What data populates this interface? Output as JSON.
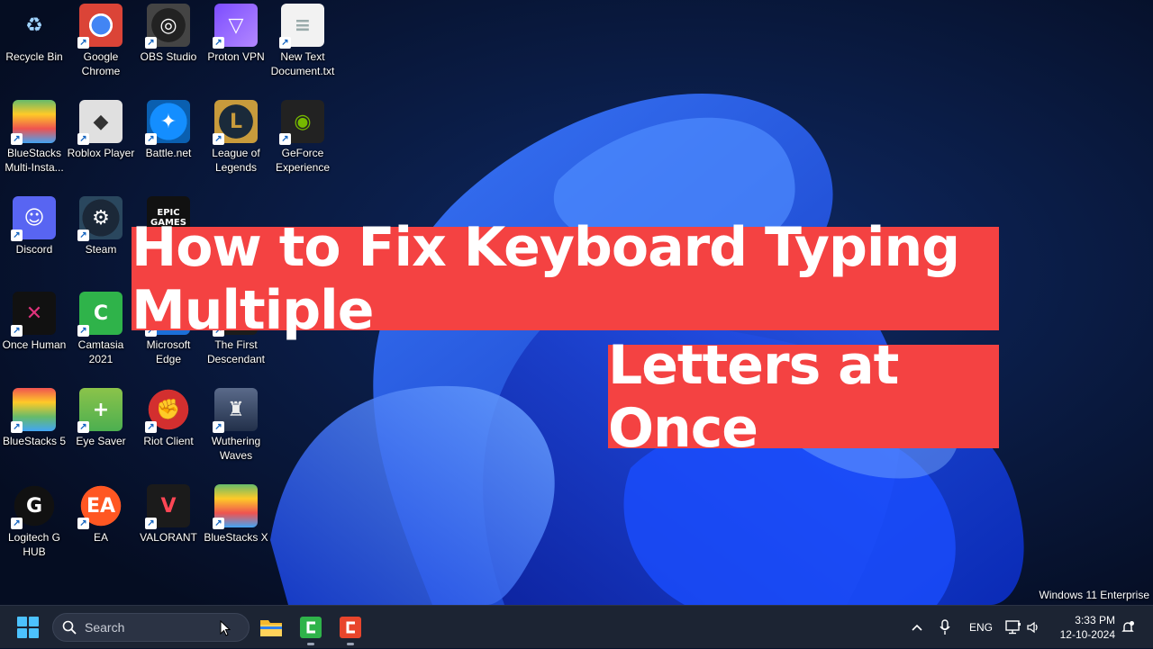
{
  "desktop": {
    "icons": [
      {
        "label": "Recycle Bin",
        "icon": "recycle-bin-icon"
      },
      {
        "label": "Google Chrome",
        "icon": "chrome-icon"
      },
      {
        "label": "OBS Studio",
        "icon": "obs-icon"
      },
      {
        "label": "Proton VPN",
        "icon": "proton-vpn-icon"
      },
      {
        "label": "New Text Document.txt",
        "icon": "text-document-icon"
      },
      {
        "label": "BlueStacks Multi-Insta...",
        "icon": "bluestacks-multi-icon"
      },
      {
        "label": "Roblox Player",
        "icon": "roblox-icon"
      },
      {
        "label": "Battle.net",
        "icon": "battlenet-icon"
      },
      {
        "label": "League of Legends",
        "icon": "league-icon"
      },
      {
        "label": "GeForce Experience",
        "icon": "geforce-icon"
      },
      {
        "label": "Discord",
        "icon": "discord-icon"
      },
      {
        "label": "Steam",
        "icon": "steam-icon"
      },
      {
        "label": "Once Human",
        "icon": "once-human-icon"
      },
      {
        "label": "Camtasia 2021",
        "icon": "camtasia-icon"
      },
      {
        "label": "Microsoft Edge",
        "icon": "edge-icon"
      },
      {
        "label": "The First Descendant",
        "icon": "first-descendant-icon"
      },
      {
        "label": "BlueStacks 5",
        "icon": "bluestacks5-icon"
      },
      {
        "label": "Eye Saver",
        "icon": "eye-saver-icon"
      },
      {
        "label": "Riot Client",
        "icon": "riot-client-icon"
      },
      {
        "label": "Wuthering Waves",
        "icon": "wuthering-waves-icon"
      },
      {
        "label": "Logitech G HUB",
        "icon": "logitech-icon"
      },
      {
        "label": "EA",
        "icon": "ea-icon"
      },
      {
        "label": "VALORANT",
        "icon": "valorant-icon"
      },
      {
        "label": "BlueStacks X",
        "icon": "bluestacks-x-icon"
      }
    ],
    "partial_icons": [
      {
        "label": "EPIC GAMES",
        "icon": "epic-games-icon"
      }
    ]
  },
  "overlay": {
    "line1": "How to Fix Keyboard Typing Multiple",
    "line2": "Letters at Once",
    "color": "#f44242"
  },
  "watermark": "Windows 11 Enterprise",
  "taskbar": {
    "search_placeholder": "Search",
    "apps": [
      {
        "name": "file-explorer-icon"
      },
      {
        "name": "camtasia-icon"
      },
      {
        "name": "camtasia-recorder-icon"
      }
    ],
    "tray": {
      "language": "ENG"
    },
    "time": "3:33 PM",
    "date": "12-10-2024"
  }
}
